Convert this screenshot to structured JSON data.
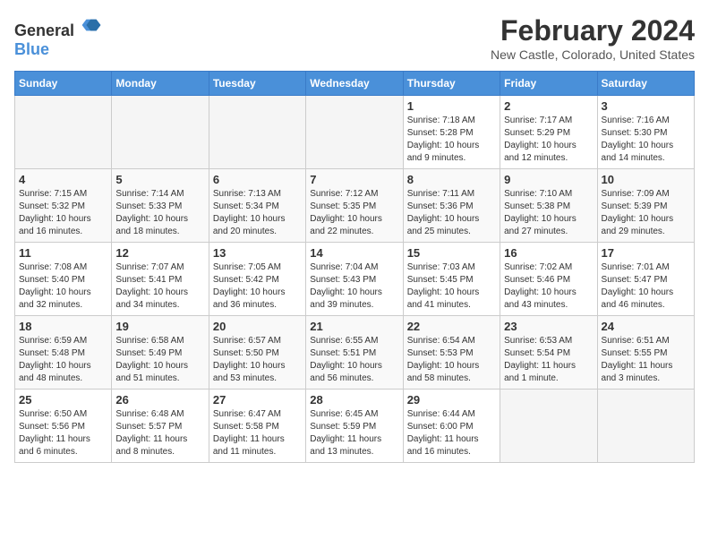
{
  "logo": {
    "general": "General",
    "blue": "Blue"
  },
  "title": "February 2024",
  "location": "New Castle, Colorado, United States",
  "days_of_week": [
    "Sunday",
    "Monday",
    "Tuesday",
    "Wednesday",
    "Thursday",
    "Friday",
    "Saturday"
  ],
  "weeks": [
    [
      {
        "day": "",
        "info": ""
      },
      {
        "day": "",
        "info": ""
      },
      {
        "day": "",
        "info": ""
      },
      {
        "day": "",
        "info": ""
      },
      {
        "day": "1",
        "info": "Sunrise: 7:18 AM\nSunset: 5:28 PM\nDaylight: 10 hours\nand 9 minutes."
      },
      {
        "day": "2",
        "info": "Sunrise: 7:17 AM\nSunset: 5:29 PM\nDaylight: 10 hours\nand 12 minutes."
      },
      {
        "day": "3",
        "info": "Sunrise: 7:16 AM\nSunset: 5:30 PM\nDaylight: 10 hours\nand 14 minutes."
      }
    ],
    [
      {
        "day": "4",
        "info": "Sunrise: 7:15 AM\nSunset: 5:32 PM\nDaylight: 10 hours\nand 16 minutes."
      },
      {
        "day": "5",
        "info": "Sunrise: 7:14 AM\nSunset: 5:33 PM\nDaylight: 10 hours\nand 18 minutes."
      },
      {
        "day": "6",
        "info": "Sunrise: 7:13 AM\nSunset: 5:34 PM\nDaylight: 10 hours\nand 20 minutes."
      },
      {
        "day": "7",
        "info": "Sunrise: 7:12 AM\nSunset: 5:35 PM\nDaylight: 10 hours\nand 22 minutes."
      },
      {
        "day": "8",
        "info": "Sunrise: 7:11 AM\nSunset: 5:36 PM\nDaylight: 10 hours\nand 25 minutes."
      },
      {
        "day": "9",
        "info": "Sunrise: 7:10 AM\nSunset: 5:38 PM\nDaylight: 10 hours\nand 27 minutes."
      },
      {
        "day": "10",
        "info": "Sunrise: 7:09 AM\nSunset: 5:39 PM\nDaylight: 10 hours\nand 29 minutes."
      }
    ],
    [
      {
        "day": "11",
        "info": "Sunrise: 7:08 AM\nSunset: 5:40 PM\nDaylight: 10 hours\nand 32 minutes."
      },
      {
        "day": "12",
        "info": "Sunrise: 7:07 AM\nSunset: 5:41 PM\nDaylight: 10 hours\nand 34 minutes."
      },
      {
        "day": "13",
        "info": "Sunrise: 7:05 AM\nSunset: 5:42 PM\nDaylight: 10 hours\nand 36 minutes."
      },
      {
        "day": "14",
        "info": "Sunrise: 7:04 AM\nSunset: 5:43 PM\nDaylight: 10 hours\nand 39 minutes."
      },
      {
        "day": "15",
        "info": "Sunrise: 7:03 AM\nSunset: 5:45 PM\nDaylight: 10 hours\nand 41 minutes."
      },
      {
        "day": "16",
        "info": "Sunrise: 7:02 AM\nSunset: 5:46 PM\nDaylight: 10 hours\nand 43 minutes."
      },
      {
        "day": "17",
        "info": "Sunrise: 7:01 AM\nSunset: 5:47 PM\nDaylight: 10 hours\nand 46 minutes."
      }
    ],
    [
      {
        "day": "18",
        "info": "Sunrise: 6:59 AM\nSunset: 5:48 PM\nDaylight: 10 hours\nand 48 minutes."
      },
      {
        "day": "19",
        "info": "Sunrise: 6:58 AM\nSunset: 5:49 PM\nDaylight: 10 hours\nand 51 minutes."
      },
      {
        "day": "20",
        "info": "Sunrise: 6:57 AM\nSunset: 5:50 PM\nDaylight: 10 hours\nand 53 minutes."
      },
      {
        "day": "21",
        "info": "Sunrise: 6:55 AM\nSunset: 5:51 PM\nDaylight: 10 hours\nand 56 minutes."
      },
      {
        "day": "22",
        "info": "Sunrise: 6:54 AM\nSunset: 5:53 PM\nDaylight: 10 hours\nand 58 minutes."
      },
      {
        "day": "23",
        "info": "Sunrise: 6:53 AM\nSunset: 5:54 PM\nDaylight: 11 hours\nand 1 minute."
      },
      {
        "day": "24",
        "info": "Sunrise: 6:51 AM\nSunset: 5:55 PM\nDaylight: 11 hours\nand 3 minutes."
      }
    ],
    [
      {
        "day": "25",
        "info": "Sunrise: 6:50 AM\nSunset: 5:56 PM\nDaylight: 11 hours\nand 6 minutes."
      },
      {
        "day": "26",
        "info": "Sunrise: 6:48 AM\nSunset: 5:57 PM\nDaylight: 11 hours\nand 8 minutes."
      },
      {
        "day": "27",
        "info": "Sunrise: 6:47 AM\nSunset: 5:58 PM\nDaylight: 11 hours\nand 11 minutes."
      },
      {
        "day": "28",
        "info": "Sunrise: 6:45 AM\nSunset: 5:59 PM\nDaylight: 11 hours\nand 13 minutes."
      },
      {
        "day": "29",
        "info": "Sunrise: 6:44 AM\nSunset: 6:00 PM\nDaylight: 11 hours\nand 16 minutes."
      },
      {
        "day": "",
        "info": ""
      },
      {
        "day": "",
        "info": ""
      }
    ]
  ]
}
